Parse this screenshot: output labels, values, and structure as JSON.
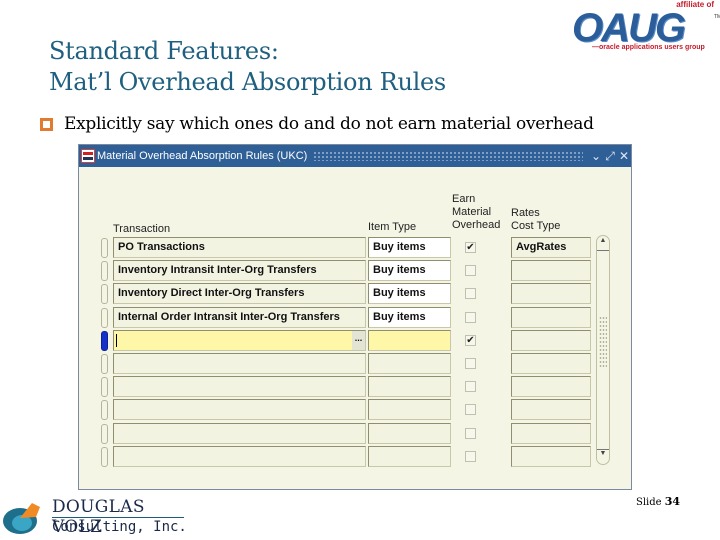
{
  "slide": {
    "title_line1": "Standard Features:",
    "title_line2": "Mat’l Overhead Absorption Rules",
    "bullet": "Explicitly say which ones do and do not earn material overhead",
    "slide_label": "Slide",
    "slide_number": "34"
  },
  "logos": {
    "oaug": {
      "affiliate": "affiliate of",
      "word": "OAUG",
      "tm": "TM",
      "tagline": "—oracle applications users group"
    },
    "dv": {
      "name": "DOUGLAS VOLZ",
      "sub": "Consulting, Inc."
    }
  },
  "window": {
    "title": "Material Overhead Absorption Rules (UKC)",
    "controls": {
      "minimize": "⌄",
      "maximize": "⤢",
      "close": "✕"
    },
    "headers": {
      "transaction": "Transaction",
      "item_type": "Item Type",
      "earn_line1": "Earn",
      "earn_line2": "Material",
      "earn_line3": "Overhead",
      "rates_line1": "Rates",
      "rates_line2": "Cost Type"
    },
    "rows": [
      {
        "transaction": "PO Transactions",
        "item_type": "Buy items",
        "earn": "✔",
        "cost_type": "AvgRates"
      },
      {
        "transaction": "Inventory Intransit Inter-Org Transfers",
        "item_type": "Buy items",
        "earn": "",
        "cost_type": ""
      },
      {
        "transaction": "Inventory Direct Inter-Org Transfers",
        "item_type": "Buy items",
        "earn": "",
        "cost_type": ""
      },
      {
        "transaction": "Internal Order Intransit Inter-Org Transfers",
        "item_type": "Buy items",
        "earn": "",
        "cost_type": ""
      },
      {
        "transaction": "",
        "item_type": "",
        "earn": "✔",
        "cost_type": ""
      },
      {
        "transaction": "",
        "item_type": "",
        "earn": "",
        "cost_type": ""
      },
      {
        "transaction": "",
        "item_type": "",
        "earn": "",
        "cost_type": ""
      },
      {
        "transaction": "",
        "item_type": "",
        "earn": "",
        "cost_type": ""
      },
      {
        "transaction": "",
        "item_type": "",
        "earn": "",
        "cost_type": ""
      },
      {
        "transaction": "",
        "item_type": "",
        "earn": "",
        "cost_type": ""
      }
    ],
    "lov_button": "...",
    "scroll_up": "▲",
    "scroll_down": "▼"
  }
}
